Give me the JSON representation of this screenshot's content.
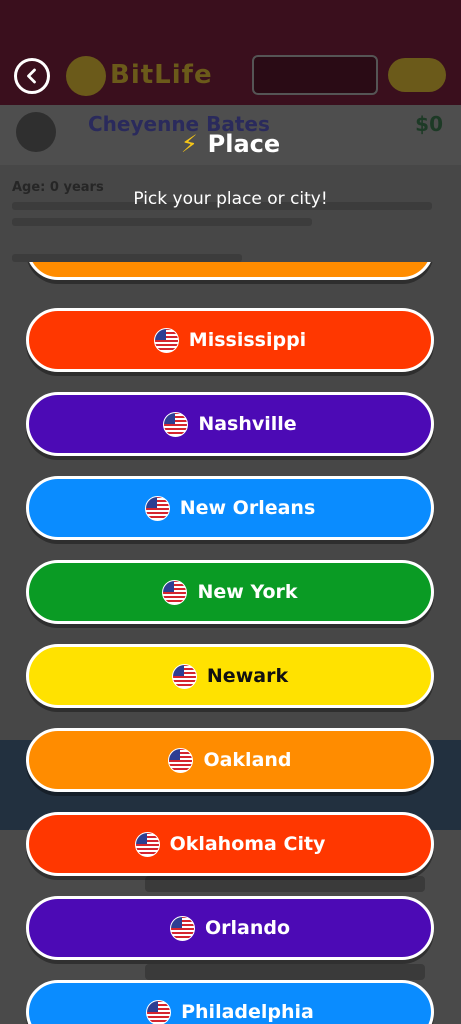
{
  "header": {
    "title": "Place",
    "title_icon": "lightning-bolt-icon",
    "subtitle": "Pick your place or city!",
    "back_icon": "chevron-left-icon"
  },
  "background": {
    "app_name": "BitLife",
    "character_name": "Cheyenne Bates",
    "money": "$0",
    "age_label": "Age: 0 years"
  },
  "places": [
    {
      "label": "Mississippi",
      "color": "#ff3700",
      "flag": "us-flag-icon"
    },
    {
      "label": "Nashville",
      "color": "#4c0ab5",
      "flag": "us-flag-icon"
    },
    {
      "label": "New Orleans",
      "color": "#0a8cff",
      "flag": "us-flag-icon"
    },
    {
      "label": "New York",
      "color": "#0a9b24",
      "flag": "us-flag-icon"
    },
    {
      "label": "Newark",
      "color": "#ffe200",
      "flag": "us-flag-icon"
    },
    {
      "label": "Oakland",
      "color": "#ff8c00",
      "flag": "us-flag-icon"
    },
    {
      "label": "Oklahoma City",
      "color": "#ff3700",
      "flag": "us-flag-icon"
    },
    {
      "label": "Orlando",
      "color": "#4c0ab5",
      "flag": "us-flag-icon"
    },
    {
      "label": "Philadelphia",
      "color": "#0a8cff",
      "flag": "us-flag-icon"
    }
  ]
}
